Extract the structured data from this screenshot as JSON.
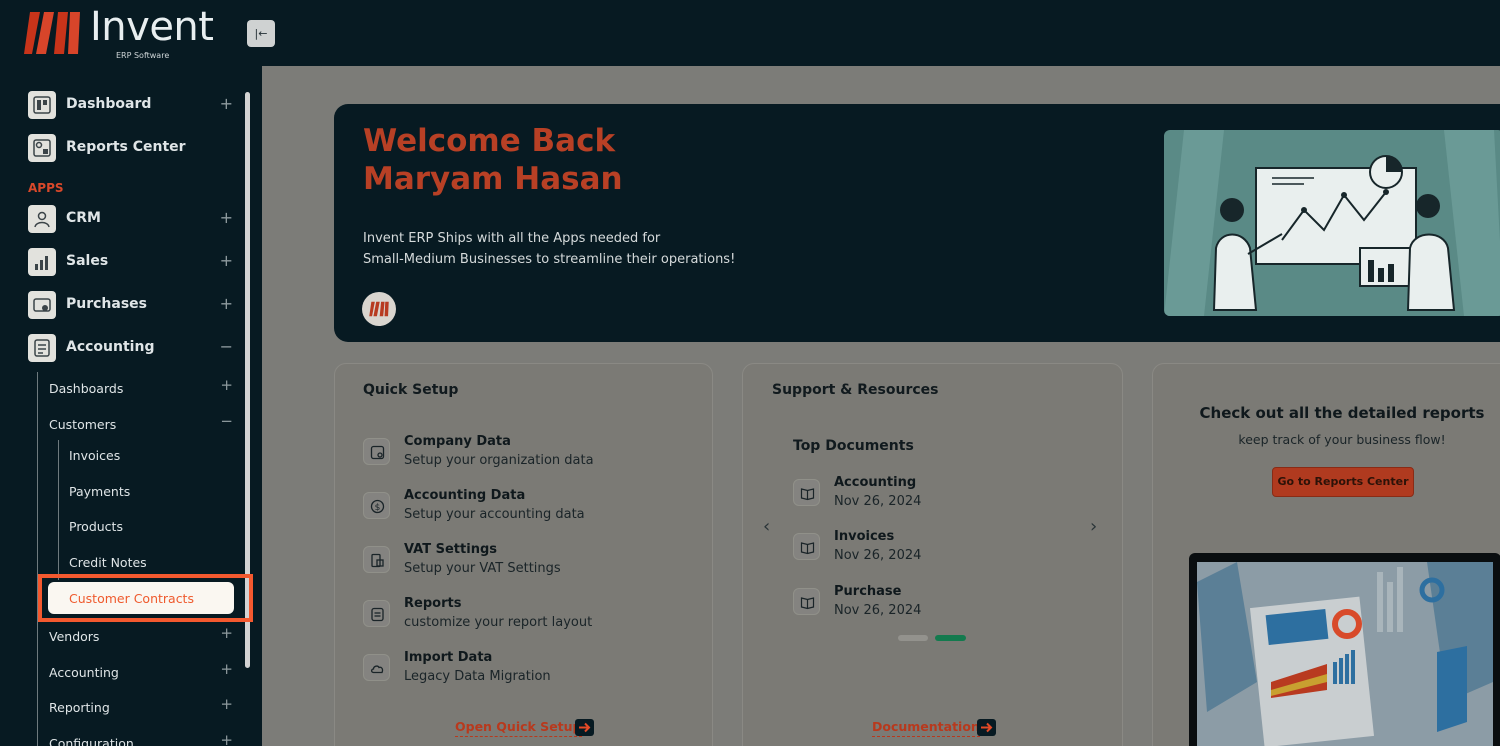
{
  "app": {
    "logo_text": "Invent",
    "logo_sub": "ERP Software",
    "collapse_icon": "collapse-left-icon"
  },
  "sidebar": {
    "main_items": [
      {
        "label": "Dashboard",
        "toggle": "+"
      },
      {
        "label": "Reports Center"
      }
    ],
    "section_label": "APPS",
    "app_items": [
      {
        "label": "CRM",
        "toggle": "+"
      },
      {
        "label": "Sales",
        "toggle": "+"
      },
      {
        "label": "Purchases",
        "toggle": "+"
      },
      {
        "label": "Accounting",
        "toggle": "−"
      }
    ],
    "accounting_children": [
      {
        "label": "Dashboards",
        "toggle": "+"
      },
      {
        "label": "Customers",
        "toggle": "−"
      }
    ],
    "customers_children": [
      "Invoices",
      "Payments",
      "Products",
      "Credit Notes"
    ],
    "active_item": "Customer Contracts",
    "after_items": [
      {
        "label": "Vendors",
        "toggle": "+"
      },
      {
        "label": "Accounting",
        "toggle": "+"
      },
      {
        "label": "Reporting",
        "toggle": "+"
      },
      {
        "label": "Configuration",
        "toggle": "+"
      }
    ]
  },
  "banner": {
    "title_line1": "Welcome Back",
    "title_line2": "Maryam Hasan",
    "desc_line1": "Invent ERP Ships with all the Apps needed for",
    "desc_line2": "Small-Medium Businesses to streamline their operations!"
  },
  "quick_setup": {
    "title": "Quick Setup",
    "items": [
      {
        "title": "Company Data",
        "sub": "Setup your organization data",
        "icon": "building-icon"
      },
      {
        "title": "Accounting Data",
        "sub": "Setup your accounting data",
        "icon": "dollar-coin-icon"
      },
      {
        "title": "VAT Settings",
        "sub": "Setup your VAT Settings",
        "icon": "vat-document-icon"
      },
      {
        "title": "Reports",
        "sub": "customize your report layout",
        "icon": "report-icon"
      },
      {
        "title": "Import Data",
        "sub": "Legacy Data Migration",
        "icon": "cloud-icon"
      }
    ],
    "link": "Open Quick Setup"
  },
  "support": {
    "title": "Support & Resources",
    "subtitle": "Top Documents",
    "docs": [
      {
        "title": "Accounting",
        "date": "Nov 26, 2024"
      },
      {
        "title": "Invoices",
        "date": "Nov 26, 2024"
      },
      {
        "title": "Purchase",
        "date": "Nov 26, 2024"
      }
    ],
    "prev": "‹",
    "next": "›",
    "link": "Documentation"
  },
  "reports": {
    "title": "Check out all the detailed reports",
    "subtitle": "keep track of your business flow!",
    "button": "Go to Reports Center"
  },
  "colors": {
    "sidebar_bg": "#071a22",
    "accent": "#f4592f",
    "overlay_bg": "#7c7c78"
  }
}
